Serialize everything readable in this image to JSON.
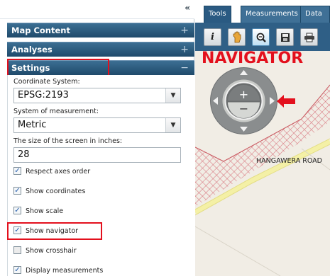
{
  "left_panel": {
    "collapse_glyph": "«",
    "sections": {
      "map_content": {
        "label": "Map Content",
        "toggle": "+"
      },
      "analyses": {
        "label": "Analyses",
        "toggle": "+"
      },
      "settings": {
        "label": "Settings",
        "toggle": "−"
      }
    },
    "settings": {
      "coordinate_system": {
        "label": "Coordinate System:",
        "value": "EPSG:2193"
      },
      "measurement_system": {
        "label": "System of measurement:",
        "value": "Metric"
      },
      "screen_size": {
        "label": "The size of the screen in inches:",
        "value": "28"
      },
      "checkboxes": [
        {
          "label": "Respect axes order",
          "checked": true
        },
        {
          "label": "Show coordinates",
          "checked": true
        },
        {
          "label": "Show scale",
          "checked": true
        },
        {
          "label": "Show navigator",
          "checked": true
        },
        {
          "label": "Show crosshair",
          "checked": false
        },
        {
          "label": "Display measurements",
          "checked": true
        }
      ]
    }
  },
  "map": {
    "tabs": [
      {
        "label": "Tools"
      },
      {
        "label": "Measurements"
      },
      {
        "label": "Data"
      }
    ],
    "toolbar_icons": [
      "info-icon",
      "pan-icon",
      "zoom-icon",
      "save-icon",
      "print-icon"
    ],
    "navigator_annotation": "NAVIGATOR",
    "navigator_buttons": {
      "zoom_in": "+",
      "zoom_out": "−"
    },
    "road_label": "HANGAWERA ROAD"
  },
  "colors": {
    "accordion": "#2a5a82",
    "highlight": "#e3101d",
    "map_background": "#f1ede5",
    "road": "#f4f0a6",
    "hatch": "#d56a75"
  }
}
